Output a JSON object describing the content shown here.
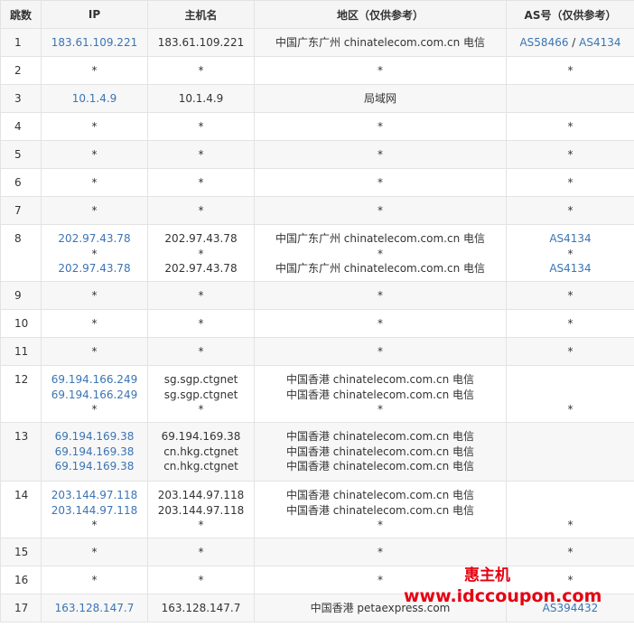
{
  "headers": [
    "跳数",
    "IP",
    "主机名",
    "地区（仅供参考）",
    "AS号（仅供参考）"
  ],
  "rows": [
    {
      "hop": "1",
      "h": 31,
      "ip": [
        {
          "t": "183.61.109.221",
          "link": true
        }
      ],
      "host": [
        "183.61.109.221"
      ],
      "loc": [
        "中国广东广州 chinatelecom.com.cn 电信"
      ],
      "as": [
        [
          {
            "t": "AS58466",
            "link": true
          },
          {
            "t": " / ",
            "link": false
          },
          {
            "t": "AS4134",
            "link": true
          }
        ]
      ]
    },
    {
      "hop": "2",
      "h": 31,
      "ip": [
        {
          "t": "*",
          "link": false
        }
      ],
      "host": [
        "*"
      ],
      "loc": [
        "*"
      ],
      "as": [
        [
          {
            "t": "*",
            "link": false
          }
        ]
      ]
    },
    {
      "hop": "3",
      "h": 31,
      "ip": [
        {
          "t": "10.1.4.9",
          "link": true
        }
      ],
      "host": [
        "10.1.4.9"
      ],
      "loc": [
        "局域网"
      ],
      "as": []
    },
    {
      "hop": "4",
      "h": 31,
      "ip": [
        {
          "t": "*",
          "link": false
        }
      ],
      "host": [
        "*"
      ],
      "loc": [
        "*"
      ],
      "as": [
        [
          {
            "t": "*",
            "link": false
          }
        ]
      ]
    },
    {
      "hop": "5",
      "h": 31,
      "ip": [
        {
          "t": "*",
          "link": false
        }
      ],
      "host": [
        "*"
      ],
      "loc": [
        "*"
      ],
      "as": [
        [
          {
            "t": "*",
            "link": false
          }
        ]
      ]
    },
    {
      "hop": "6",
      "h": 31,
      "ip": [
        {
          "t": "*",
          "link": false
        }
      ],
      "host": [
        "*"
      ],
      "loc": [
        "*"
      ],
      "as": [
        [
          {
            "t": "*",
            "link": false
          }
        ]
      ]
    },
    {
      "hop": "7",
      "h": 31,
      "ip": [
        {
          "t": "*",
          "link": false
        }
      ],
      "host": [
        "*"
      ],
      "loc": [
        "*"
      ],
      "as": [
        [
          {
            "t": "*",
            "link": false
          }
        ]
      ]
    },
    {
      "hop": "8",
      "h": 63,
      "ip": [
        {
          "t": "202.97.43.78",
          "link": true
        },
        {
          "t": "*",
          "link": false
        },
        {
          "t": "202.97.43.78",
          "link": true
        }
      ],
      "host": [
        "202.97.43.78",
        "*",
        "202.97.43.78"
      ],
      "loc": [
        "中国广东广州 chinatelecom.com.cn 电信",
        "*",
        "中国广东广州 chinatelecom.com.cn 电信"
      ],
      "as": [
        [
          {
            "t": "AS4134",
            "link": true
          }
        ],
        [
          {
            "t": "*",
            "link": false
          }
        ],
        [
          {
            "t": "AS4134",
            "link": true
          }
        ]
      ]
    },
    {
      "hop": "9",
      "h": 31,
      "ip": [
        {
          "t": "*",
          "link": false
        }
      ],
      "host": [
        "*"
      ],
      "loc": [
        "*"
      ],
      "as": [
        [
          {
            "t": "*",
            "link": false
          }
        ]
      ]
    },
    {
      "hop": "10",
      "h": 31,
      "ip": [
        {
          "t": "*",
          "link": false
        }
      ],
      "host": [
        "*"
      ],
      "loc": [
        "*"
      ],
      "as": [
        [
          {
            "t": "*",
            "link": false
          }
        ]
      ]
    },
    {
      "hop": "11",
      "h": 31,
      "ip": [
        {
          "t": "*",
          "link": false
        }
      ],
      "host": [
        "*"
      ],
      "loc": [
        "*"
      ],
      "as": [
        [
          {
            "t": "*",
            "link": false
          }
        ]
      ]
    },
    {
      "hop": "12",
      "h": 63,
      "ip": [
        {
          "t": "69.194.166.249",
          "link": true
        },
        {
          "t": "69.194.166.249",
          "link": true
        },
        {
          "t": "*",
          "link": false
        }
      ],
      "host": [
        "sg.sgp.ctgnet",
        "sg.sgp.ctgnet",
        "*"
      ],
      "loc": [
        "中国香港 chinatelecom.com.cn 电信",
        "中国香港 chinatelecom.com.cn 电信",
        "*"
      ],
      "as": [
        [],
        [],
        [
          {
            "t": "*",
            "link": false
          }
        ]
      ]
    },
    {
      "hop": "13",
      "h": 65,
      "ip": [
        {
          "t": "69.194.169.38",
          "link": true
        },
        {
          "t": "69.194.169.38",
          "link": true
        },
        {
          "t": "69.194.169.38",
          "link": true
        }
      ],
      "host": [
        "69.194.169.38",
        "cn.hkg.ctgnet",
        "cn.hkg.ctgnet"
      ],
      "loc": [
        "中国香港 chinatelecom.com.cn 电信",
        "中国香港 chinatelecom.com.cn 电信",
        "中国香港 chinatelecom.com.cn 电信"
      ],
      "as": []
    },
    {
      "hop": "14",
      "h": 63,
      "ip": [
        {
          "t": "203.144.97.118",
          "link": true
        },
        {
          "t": "203.144.97.118",
          "link": true
        },
        {
          "t": "*",
          "link": false
        }
      ],
      "host": [
        "203.144.97.118",
        "203.144.97.118",
        "*"
      ],
      "loc": [
        "中国香港 chinatelecom.com.cn 电信",
        "中国香港 chinatelecom.com.cn 电信",
        "*"
      ],
      "as": [
        [],
        [],
        [
          {
            "t": "*",
            "link": false
          }
        ]
      ]
    },
    {
      "hop": "15",
      "h": 31,
      "ip": [
        {
          "t": "*",
          "link": false
        }
      ],
      "host": [
        "*"
      ],
      "loc": [
        "*"
      ],
      "as": [
        [
          {
            "t": "*",
            "link": false
          }
        ]
      ]
    },
    {
      "hop": "16",
      "h": 31,
      "ip": [
        {
          "t": "*",
          "link": false
        }
      ],
      "host": [
        "*"
      ],
      "loc": [
        "*"
      ],
      "as": [
        [
          {
            "t": "*",
            "link": false
          }
        ]
      ]
    },
    {
      "hop": "17",
      "h": 31,
      "ip": [
        {
          "t": "163.128.147.7",
          "link": true
        }
      ],
      "host": [
        "163.128.147.7"
      ],
      "loc": [
        "中国香港 petaexpress.com"
      ],
      "as": [
        [
          {
            "t": "AS394432",
            "link": true
          }
        ]
      ]
    }
  ],
  "watermark": {
    "line1": "惠主机",
    "line2": "www.idccoupon.com",
    "color": "#e60012"
  },
  "colors": {
    "link": "#3b74b3",
    "header_bg": "#f5f5f5",
    "stripe_bg": "#f7f7f7",
    "border": "#e3e3e3"
  }
}
